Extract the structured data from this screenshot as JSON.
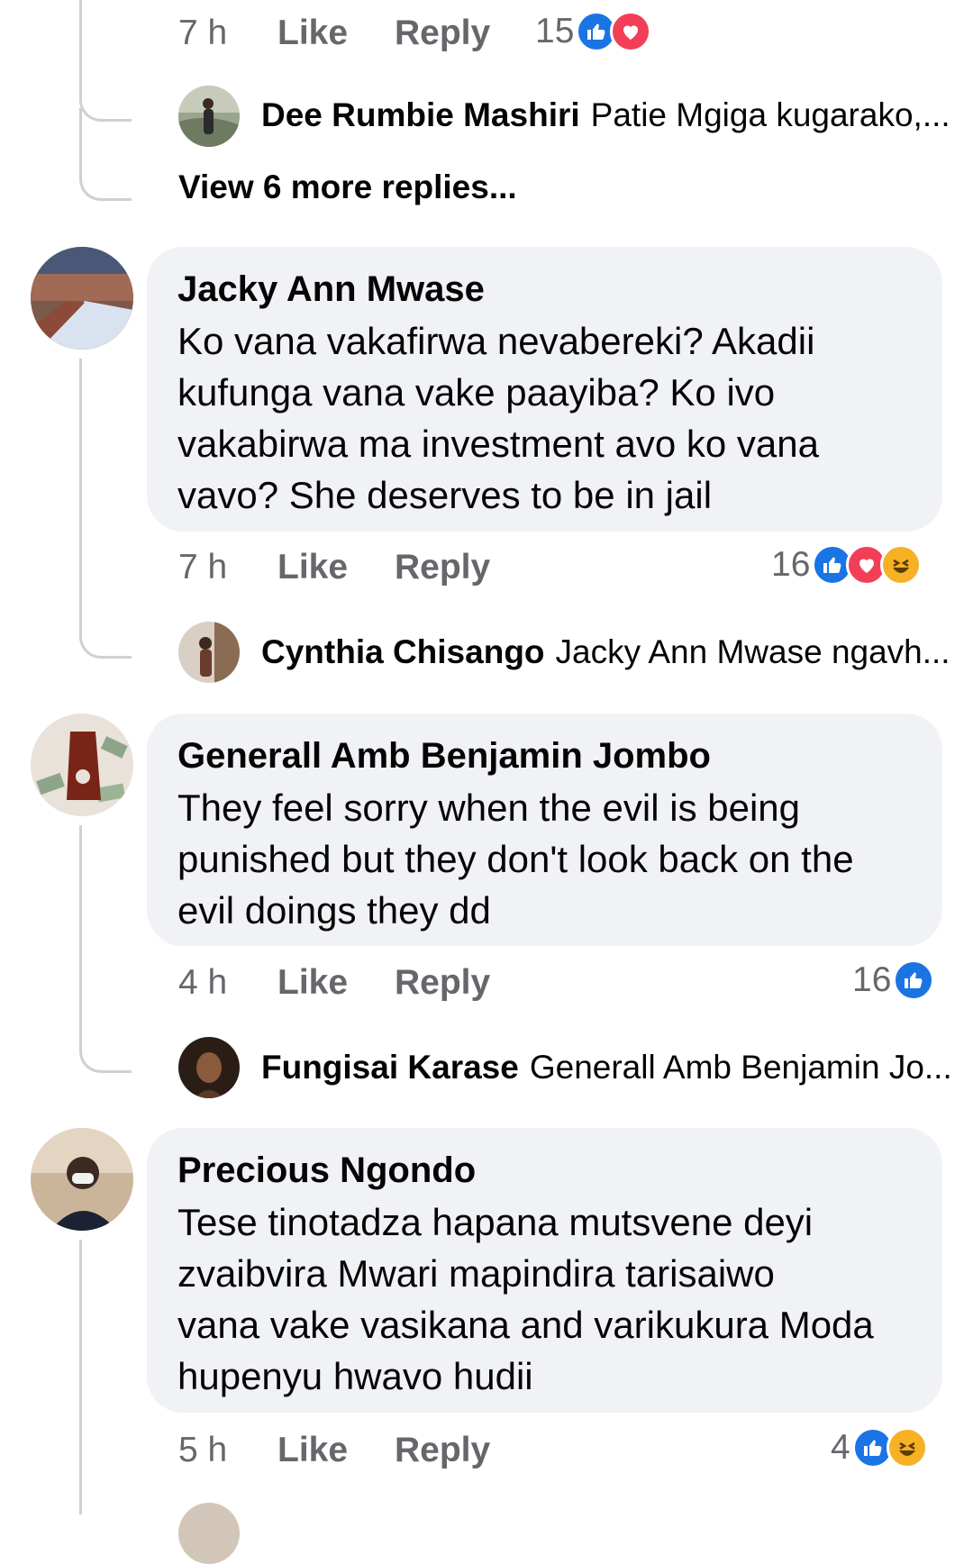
{
  "colors": {
    "like": "#1b74e4",
    "love": "#f33e58",
    "haha": "#f7b125",
    "meta": "#65676b",
    "bubble": "#f0f2f5",
    "thread": "#ced0d4"
  },
  "top": {
    "time": "7 h",
    "like": "Like",
    "reply": "Reply",
    "reaction_count": "15",
    "reactions": [
      "like-icon",
      "love-icon"
    ]
  },
  "top_reply": {
    "name": "Dee Rumbie Mashiri",
    "text": "Patie Mgiga kugarako,..."
  },
  "view_more": "View 6 more replies...",
  "comments": [
    {
      "name": "Jacky Ann Mwase",
      "lines": [
        "Ko vana vakafirwa nevabereki? Akadii",
        "kufunga vana vake paayiba? Ko ivo",
        "vakabirwa ma investment avo ko vana",
        "vavo? She deserves to be in jail"
      ],
      "time": "7 h",
      "like": "Like",
      "reply": "Reply",
      "reaction_count": "16",
      "reactions": [
        "like-icon",
        "love-icon",
        "haha-icon"
      ],
      "reply_preview": {
        "name": "Cynthia Chisango",
        "text": "Jacky Ann Mwase ngavh..."
      }
    },
    {
      "name": "Generall Amb Benjamin Jombo",
      "lines": [
        "They feel sorry when the evil is being",
        "punished but they don't look back on the",
        "evil doings they dd"
      ],
      "time": "4 h",
      "like": "Like",
      "reply": "Reply",
      "reaction_count": "16",
      "reactions": [
        "like-icon"
      ],
      "reply_preview": {
        "name": "Fungisai Karase",
        "text": "Generall Amb Benjamin Jo..."
      }
    },
    {
      "name": "Precious Ngondo",
      "lines": [
        "Tese tinotadza hapana mutsvene deyi",
        "zvaibvira Mwari mapindira tarisaiwo",
        "vana vake vasikana and varikukura Moda",
        "hupenyu hwavo hudii"
      ],
      "time": "5 h",
      "like": "Like",
      "reply": "Reply",
      "reaction_count": "4",
      "reactions": [
        "like-icon",
        "haha-icon"
      ]
    }
  ]
}
